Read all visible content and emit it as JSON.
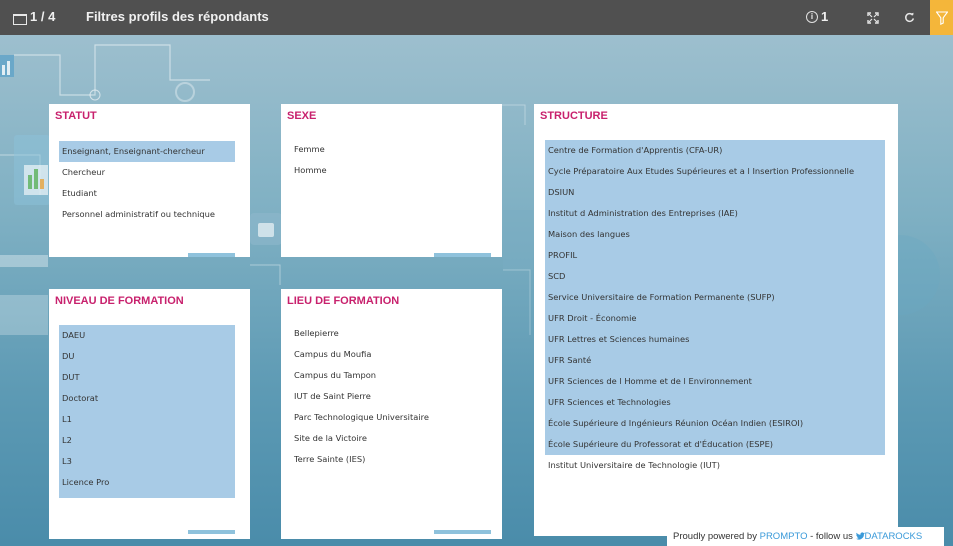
{
  "header": {
    "page_counter": "1 / 4",
    "title": "Filtres profils des répondants",
    "info_count": "1"
  },
  "filters": {
    "statut": {
      "title": "STATUT",
      "options": [
        "Enseignant, Enseignant-chercheur",
        "Chercheur",
        "Etudiant",
        "Personnel administratif ou technique"
      ],
      "selected": [
        0
      ]
    },
    "sexe": {
      "title": "SEXE",
      "options": [
        "Femme",
        "Homme"
      ],
      "selected": []
    },
    "structure": {
      "title": "STRUCTURE",
      "options": [
        "Centre de Formation d'Apprentis (CFA-UR)",
        "Cycle Préparatoire Aux Etudes Supérieures et a l Insertion Professionnelle",
        "DSIUN",
        "Institut d Administration des Entreprises (IAE)",
        "Maison des langues",
        "PROFIL",
        "SCD",
        "Service Universitaire de Formation Permanente (SUFP)",
        "UFR Droit - Économie",
        "UFR Lettres et Sciences humaines",
        "UFR Santé",
        "UFR Sciences de l Homme et de l Environnement",
        "UFR Sciences et Technologies",
        "École Supérieure d Ingénieurs Réunion Océan Indien (ESIROI)",
        "École Supérieure du Professorat et d'Éducation (ESPE)",
        "Institut Universitaire de Technologie (IUT)"
      ],
      "selected": [
        0,
        1,
        2,
        3,
        4,
        5,
        6,
        7,
        8,
        9,
        10,
        11,
        12,
        13,
        14
      ]
    },
    "niveau": {
      "title": "NIVEAU DE FORMATION",
      "options": [
        "DAEU",
        "DU",
        "DUT",
        "Doctorat",
        "L1",
        "L2",
        "L3",
        "Licence Pro"
      ],
      "selected": [
        0,
        1,
        2,
        3,
        4,
        5,
        6,
        7
      ]
    },
    "lieu": {
      "title": "LIEU DE FORMATION",
      "options": [
        "Bellepierre",
        "Campus du Moufia",
        "Campus du Tampon",
        "IUT de Saint Pierre",
        "Parc Technologique Universitaire",
        "Site de la Victoire",
        "Terre Sainte (IES)"
      ],
      "selected": []
    }
  },
  "footer": {
    "prefix": "Proudly powered by ",
    "brand": "PROMPTO",
    "middle": " - follow us ",
    "twitter_icon": "twitter-bird-icon",
    "handle": "DATAROCKS"
  },
  "colors": {
    "topbar": "#505050",
    "accent_filter": "#f4b63a",
    "title_pink": "#c8216d",
    "selection": "#a8cbe6",
    "link_blue": "#3a9ad9"
  },
  "icons": {
    "slides": "slides-icon",
    "info": "info-icon",
    "fullscreen": "fullscreen-icon",
    "refresh": "refresh-icon",
    "filter": "filter-icon"
  }
}
